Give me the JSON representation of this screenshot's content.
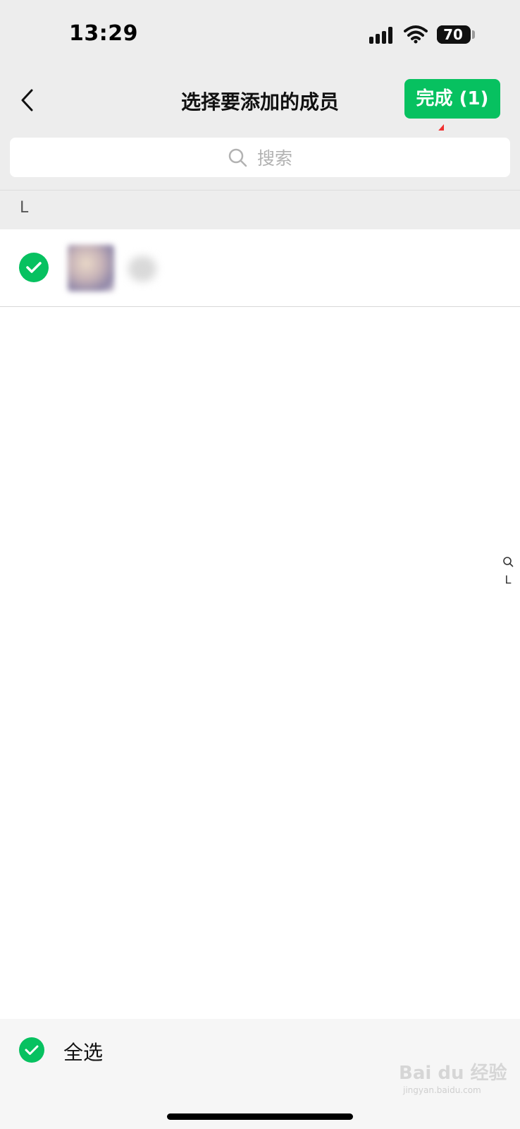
{
  "status_bar": {
    "time": "13:29",
    "battery_level": 70,
    "battery_text": "70"
  },
  "nav": {
    "title": "选择要添加的成员",
    "done_label": "完成 (1)",
    "back_icon": "chevron-left-icon"
  },
  "search": {
    "placeholder": "搜索",
    "icon": "search-icon"
  },
  "section": {
    "letter": "L"
  },
  "members": [
    {
      "selected": true
    }
  ],
  "index_bar": {
    "letter": "L"
  },
  "footer": {
    "select_all_label": "全选",
    "select_all_checked": true
  },
  "watermark": {
    "text": "Bai du 经验",
    "sub": "jingyan.baidu.com"
  },
  "colors": {
    "accent": "#07c160",
    "nav_bg": "#ededed",
    "arrow": "#f03030"
  }
}
